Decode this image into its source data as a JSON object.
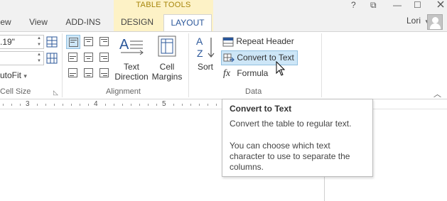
{
  "context_tab_group": "TABLE TOOLS",
  "tabs": [
    {
      "label": "ew"
    },
    {
      "label": "View"
    },
    {
      "label": "ADD-INS"
    },
    {
      "label": "DESIGN"
    },
    {
      "label": "LAYOUT"
    }
  ],
  "window_controls": {
    "help": "?",
    "restore": "⧉",
    "minimize": "—",
    "maximize": "☐"
  },
  "user": {
    "name": "Lori",
    "caret": "▾"
  },
  "cell_size": {
    "height_value": ".19\"",
    "autofit_label": "utoFit",
    "autofit_caret": "▾",
    "group_label": "Cell Size"
  },
  "alignment": {
    "text_direction_label_1": "Text",
    "text_direction_label_2": "Direction",
    "cell_margins_label_1": "Cell",
    "cell_margins_label_2": "Margins",
    "group_label": "Alignment"
  },
  "data_group": {
    "sort_label": "Sort",
    "repeat_header_rows": "Repeat Header Rows",
    "convert_to_text": "Convert to Text",
    "formula": "Formula",
    "formula_icon": "fx",
    "group_label": "Data"
  },
  "ruler": {
    "numbers": [
      "3",
      "4",
      "5"
    ]
  },
  "tooltip": {
    "title": "Convert to Text",
    "body": "Convert the table to regular text.",
    "body2": "You can choose which text character to use to separate the columns."
  },
  "colors": {
    "accent": "#2b579a",
    "context_band": "#fdf2c6",
    "context_text": "#a7860c",
    "hover": "#cde6f7"
  }
}
